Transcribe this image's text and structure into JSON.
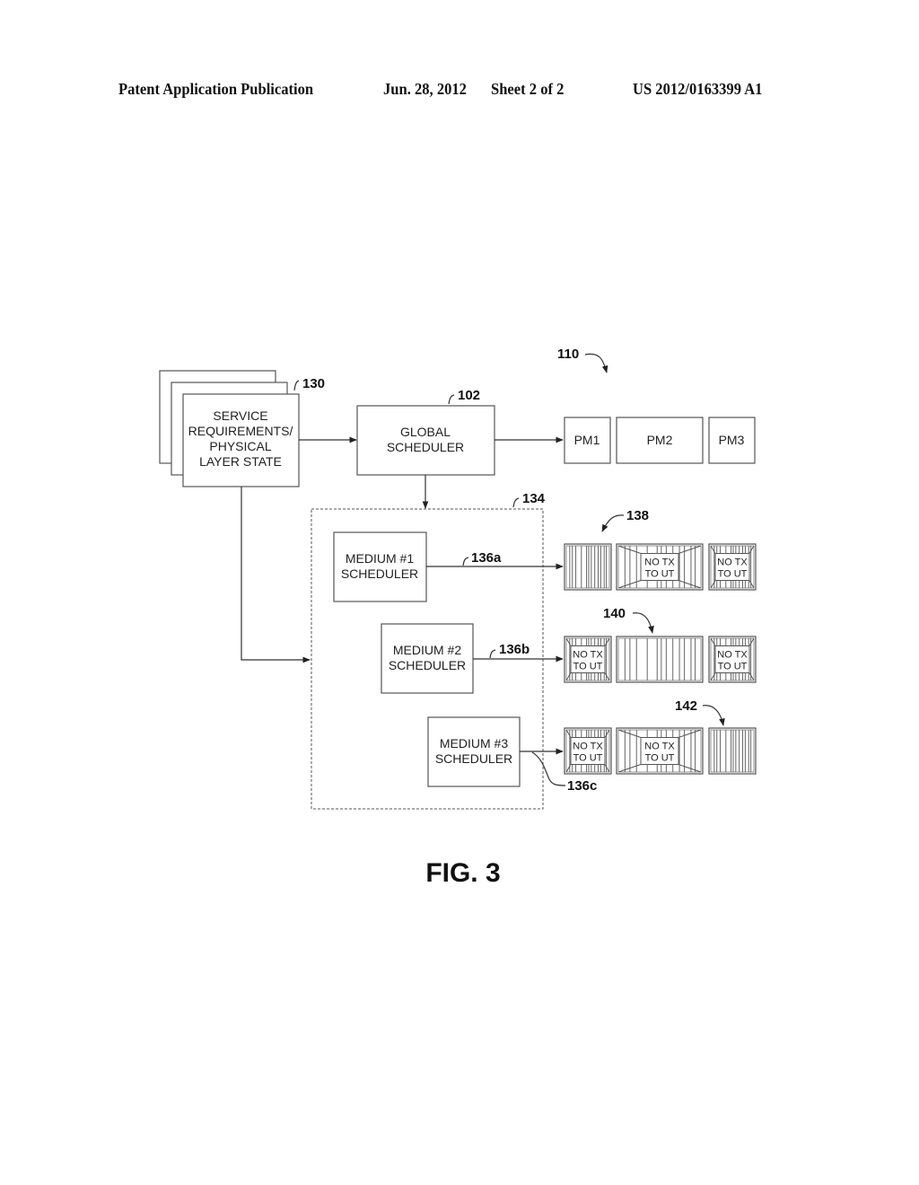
{
  "header": {
    "publication_type": "Patent Application Publication",
    "date": "Jun. 28, 2012",
    "sheet": "Sheet 2 of 2",
    "patent_number": "US 2012/0163399 A1"
  },
  "figure": {
    "caption": "FIG. 3",
    "system_ref": "110",
    "service_block": {
      "ref": "130",
      "lines": [
        "SERVICE",
        "REQUIREMENTS/",
        "PHYSICAL",
        "LAYER STATE"
      ]
    },
    "global_scheduler": {
      "ref": "102",
      "lines": [
        "GLOBAL",
        "SCHEDULER"
      ]
    },
    "physical_media": [
      "PM1",
      "PM2",
      "PM3"
    ],
    "medium_group_ref": "134",
    "medium_schedulers": [
      {
        "lines": [
          "MEDIUM #1",
          "SCHEDULER"
        ],
        "output_ref": "136a"
      },
      {
        "lines": [
          "MEDIUM #2",
          "SCHEDULER"
        ],
        "output_ref": "136b"
      },
      {
        "lines": [
          "MEDIUM #3",
          "SCHEDULER"
        ],
        "output_ref": "136c"
      }
    ],
    "frame_rows": [
      {
        "ref": "138",
        "slots": [
          "active",
          "blocked",
          "blocked"
        ]
      },
      {
        "ref": "140",
        "slots": [
          "blocked",
          "active",
          "blocked"
        ]
      },
      {
        "ref": "142",
        "slots": [
          "blocked",
          "blocked",
          "active"
        ]
      }
    ],
    "blocked_label": [
      "NO TX",
      "TO UT"
    ]
  }
}
